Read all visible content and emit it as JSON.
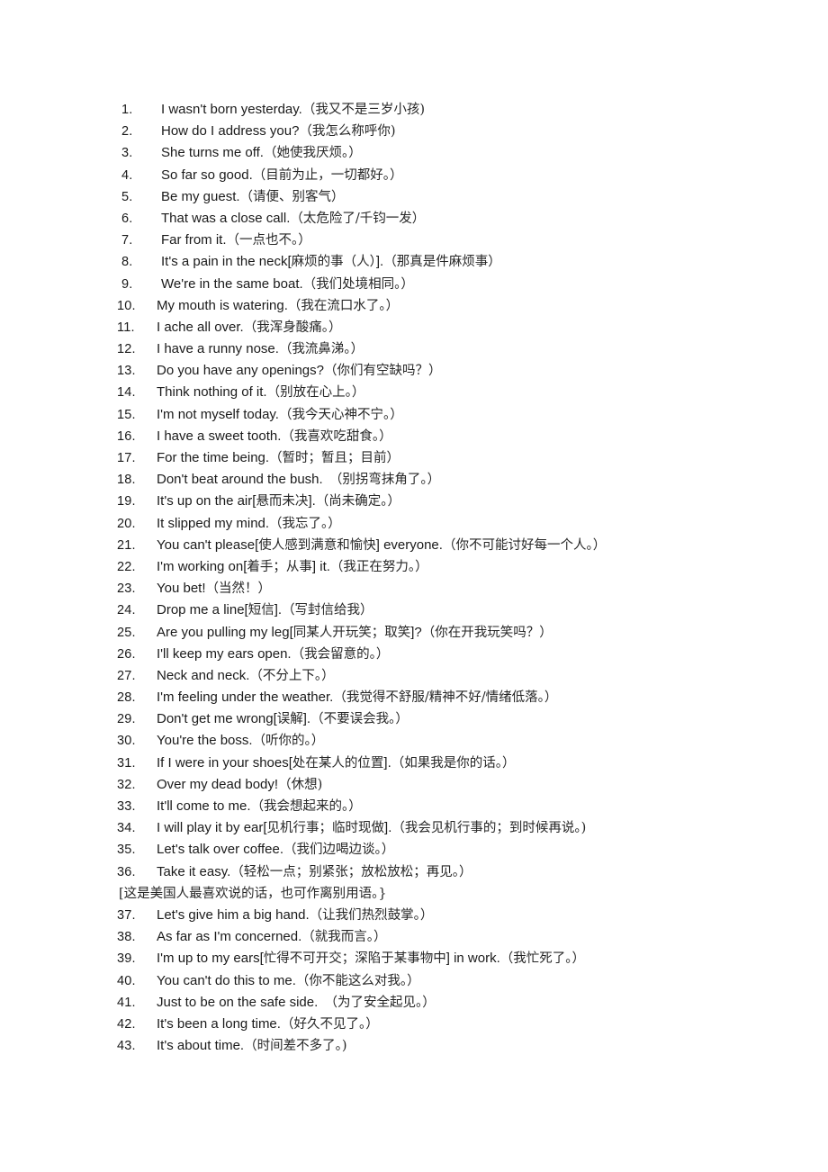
{
  "document": {
    "background_color": "#ffffff",
    "text_color": "#1a1a1a",
    "items": [
      {
        "n": "1.",
        "en": "I wasn't born yesterday.",
        "cn": "（我又不是三岁小孩)"
      },
      {
        "n": "2.",
        "en": "How do I address you?",
        "cn": "（我怎么称呼你)"
      },
      {
        "n": "3.",
        "en": "She turns me off.",
        "cn": "（她使我厌烦。）"
      },
      {
        "n": "4.",
        "en": "So far so good.",
        "cn": "（目前为止，一切都好。）"
      },
      {
        "n": "5.",
        "en": "Be my guest.",
        "cn": "（请便、别客气）"
      },
      {
        "n": "6.",
        "en": "That was a close call.",
        "cn": "（太危险了/千钧一发）"
      },
      {
        "n": "7.",
        "en": "Far from it.",
        "cn": "（一点也不。）"
      },
      {
        "n": "8.",
        "en": "It's a pain in the neck[",
        "cn": "麻烦的事（人）",
        "en2": "].",
        "cn2": "（那真是件麻烦事）"
      },
      {
        "n": "9.",
        "en": "We're in the same boat.",
        "cn": "（我们处境相同。）"
      },
      {
        "n": "10.",
        "en": "My mouth is watering.",
        "cn": "（我在流口水了。）"
      },
      {
        "n": "11.",
        "en": "I ache all over.",
        "cn": "（我浑身酸痛。）"
      },
      {
        "n": "12.",
        "en": "I have a runny nose.",
        "cn": "（我流鼻涕。）"
      },
      {
        "n": "13.",
        "en": "Do you have any openings?",
        "cn": "（你们有空缺吗？）"
      },
      {
        "n": "14.",
        "en": "Think nothing of it.",
        "cn": "（别放在心上。）"
      },
      {
        "n": "15.",
        "en": "I'm not myself today.",
        "cn": "（我今天心神不宁。）"
      },
      {
        "n": "16.",
        "en": "I have a sweet tooth.",
        "cn": "（我喜欢吃甜食。）"
      },
      {
        "n": "17.",
        "en": "For the time being.",
        "cn": "（暂时；暂且；目前）"
      },
      {
        "n": "18.",
        "en": "Don't beat around the bush.",
        "cn": "　（别拐弯抹角了。）"
      },
      {
        "n": "19.",
        "en": "It's up on the air[",
        "cn": "悬而未决",
        "en2": "].",
        "cn2": "（尚未确定。）"
      },
      {
        "n": "20.",
        "en": "It slipped my mind.",
        "cn": "（我忘了。）"
      },
      {
        "n": "21.",
        "en": "You can't please[",
        "cn": "使人感到满意和愉快",
        "en2": "] everyone.",
        "cn2": "（你不可能讨好每一个人。）"
      },
      {
        "n": "22.",
        "en": "I'm working on[",
        "cn": "着手；从事",
        "en2": "] it.",
        "cn2": "（我正在努力。）"
      },
      {
        "n": "23.",
        "en": "You bet!",
        "cn": "（当然！）"
      },
      {
        "n": "24.",
        "en": "Drop me a line[",
        "cn": "短信",
        "en2": "].",
        "cn2": "（写封信给我）"
      },
      {
        "n": "25.",
        "en": "Are you pulling my leg[",
        "cn": "同某人开玩笑；取笑",
        "en2": "]?",
        "cn2": "（你在开我玩笑吗？）"
      },
      {
        "n": "26.",
        "en": "I'll keep my ears open.",
        "cn": "（我会留意的。）"
      },
      {
        "n": "27.",
        "en": "Neck and neck.",
        "cn": "（不分上下。）"
      },
      {
        "n": "28.",
        "en": "I'm feeling under the weather.",
        "cn": "（我觉得不舒服/精神不好/情绪低落。）"
      },
      {
        "n": "29.",
        "en": "Don't get me wrong[",
        "cn": "误解",
        "en2": "].",
        "cn2": "（不要误会我。）"
      },
      {
        "n": "30.",
        "en": "You're the boss.",
        "cn": "（听你的。）"
      },
      {
        "n": "31.",
        "en": "If I were in your shoes[",
        "cn": "处在某人的位置",
        "en2": "].",
        "cn2": "（如果我是你的话。）"
      },
      {
        "n": "32.",
        "en": "Over my dead body!",
        "cn": "（休想)"
      },
      {
        "n": "33.",
        "en": "It'll come to me.",
        "cn": "（我会想起来的。）"
      },
      {
        "n": "34.",
        "en": "I will play it by ear[",
        "cn": "见机行事；临时现做",
        "en2": "].",
        "cn2": "（我会见机行事的；到时候再说。)"
      },
      {
        "n": "35.",
        "en": "Let's talk over coffee.",
        "cn": "（我们边喝边谈。）"
      },
      {
        "n": "36.",
        "en": "Take it easy.",
        "cn": "（轻松一点；别紧张；放松放松；再见。）"
      }
    ],
    "note": "[这是美国人最喜欢说的话，也可作离别用语。}",
    "items_after_note": [
      {
        "n": "37.",
        "en": "Let's give him a big hand.",
        "cn": "（让我们热烈鼓掌。）"
      },
      {
        "n": "38.",
        "en": "As far as I'm concerned.",
        "cn": "（就我而言。）"
      },
      {
        "n": "39.",
        "en": "I'm up to my ears[",
        "cn": "忙得不可开交；深陷于某事物中",
        "en2": "] in work.",
        "cn2": "（我忙死了。）"
      },
      {
        "n": "40.",
        "en": "You can't do this to me.",
        "cn": "（你不能这么对我。）"
      },
      {
        "n": "41.",
        "en": "Just to be on the safe side.",
        "cn": "　（为了安全起见。）"
      },
      {
        "n": "42.",
        "en": "It's been a long time.",
        "cn": "（好久不见了。）"
      },
      {
        "n": "43.",
        "en": "It's about time.",
        "cn": "（时间差不多了。)"
      }
    ]
  }
}
